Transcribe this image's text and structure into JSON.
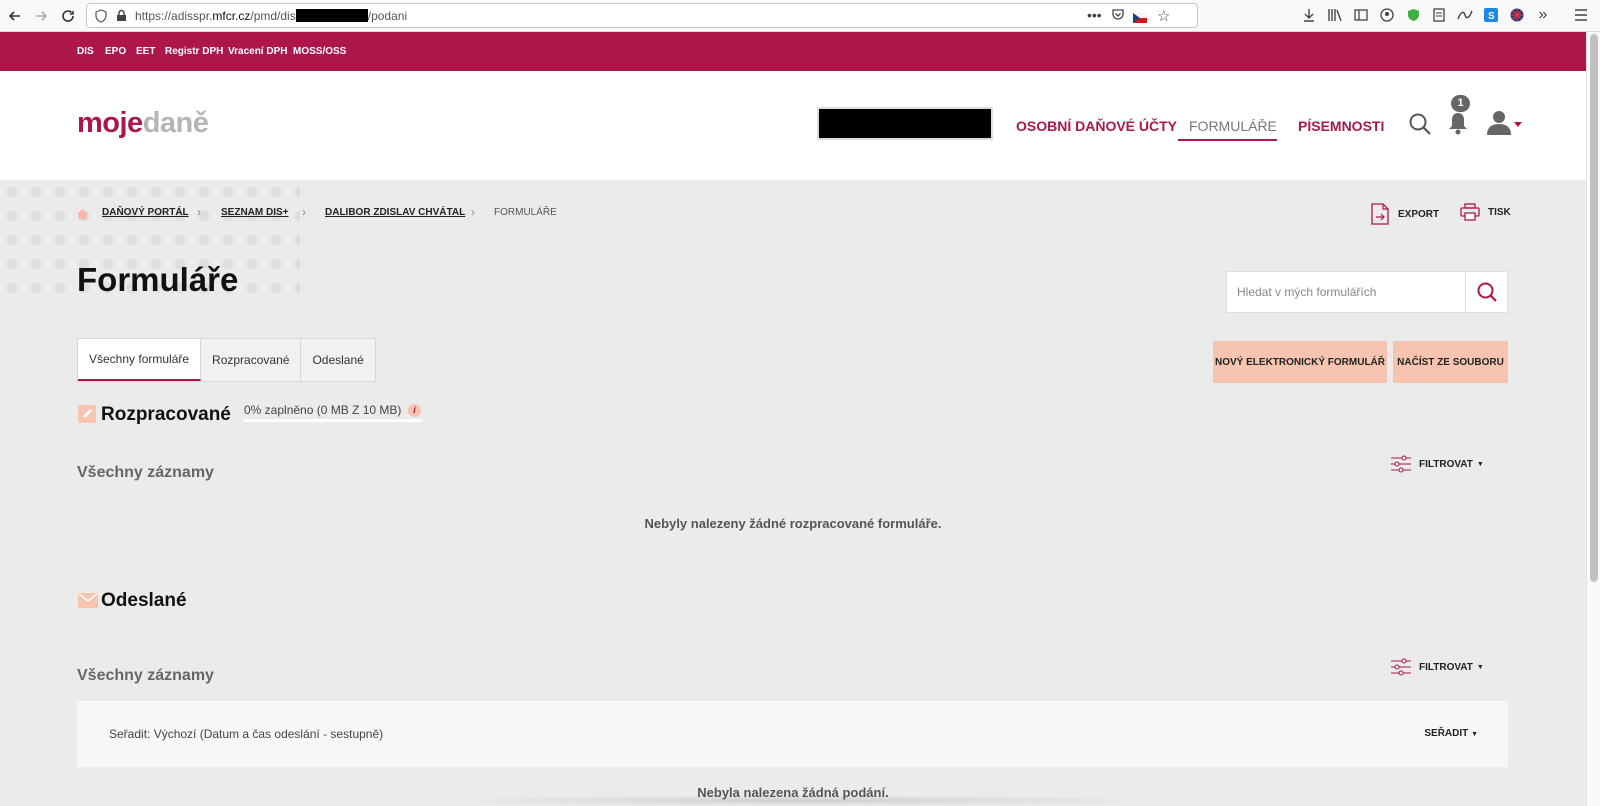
{
  "browser": {
    "url_prefix": "https://adisspr.",
    "url_domain": "mfcr.cz",
    "url_path": "/pmd/dis",
    "url_suffix": "/podani"
  },
  "topbar": {
    "links": [
      "DIS",
      "EPO",
      "EET",
      "Registr DPH",
      "Vracení DPH",
      "MOSS/OSS"
    ]
  },
  "header": {
    "logo_moje": "moje",
    "logo_dane": "daně",
    "nav": [
      "OSOBNÍ DAŇOVÉ ÚČTY",
      "FORMULÁŘE",
      "PÍSEMNOSTI"
    ],
    "notification_count": "1"
  },
  "breadcrumb": [
    "DAŇOVÝ PORTÁL",
    "SEZNAM DIS+",
    "DALIBOR ZDISLAV CHVÁTAL",
    "FORMULÁŘE"
  ],
  "tools": {
    "export": "EXPORT",
    "print": "TISK"
  },
  "page_title": "Formuláře",
  "search": {
    "placeholder": "Hledat v mých formulářích"
  },
  "tabs": [
    "Všechny formuláře",
    "Rozpracované",
    "Odeslané"
  ],
  "actions": {
    "new_form": "NOVÝ ELEKTRONICKÝ FORMULÁŘ",
    "load_file": "NAČÍST ZE SOUBORU"
  },
  "drafts": {
    "title": "Rozpracované",
    "storage": "0% zaplněno (0 MB Z 10 MB)",
    "storage_fraction": 0,
    "records_label": "Všechny záznamy",
    "filter_label": "FILTROVAT",
    "empty": "Nebyly nalezeny žádné rozpracované formuláře."
  },
  "sent": {
    "title": "Odeslané",
    "records_label": "Všechny záznamy",
    "filter_label": "FILTROVAT",
    "sort_text": "Seřadit: Výchozí (Datum a čas odeslání - sestupně)",
    "sort_button": "SEŘADIT",
    "empty": "Nebyla nalezena žádná podání."
  },
  "colors": {
    "brand": "#ad164b",
    "accent": "#f7c4b0",
    "page_bg": "#ebebeb"
  }
}
